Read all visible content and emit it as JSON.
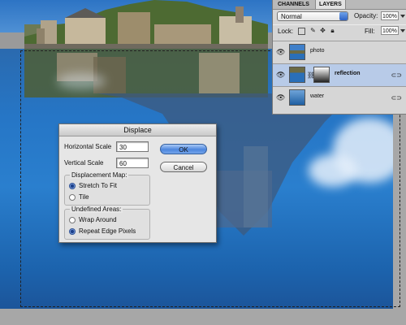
{
  "colors": {
    "panel_bg": "#d6d6d6",
    "selected_layer": "#b8cbe8",
    "dialog_bg": "#e6e6e6",
    "ok_button": "#4d86de",
    "water_blue": "#2676c6"
  },
  "layers_panel": {
    "tabs": [
      "CHANNELS",
      "LAYERS"
    ],
    "active_tab": "LAYERS",
    "blend_mode": "Normal",
    "opacity_label": "Opacity:",
    "opacity_value": "100%",
    "lock_label": "Lock:",
    "fill_label": "Fill:",
    "fill_value": "100%",
    "lock_icons": [
      "lock-transparency-icon",
      "lock-image-icon",
      "lock-position-icon",
      "lock-all-icon"
    ],
    "layers": [
      {
        "name": "photo",
        "visible": true,
        "selected": false,
        "has_mask": false
      },
      {
        "name": "reflection",
        "visible": true,
        "selected": true,
        "has_mask": true
      },
      {
        "name": "water",
        "visible": true,
        "selected": false,
        "has_mask": false
      }
    ]
  },
  "dialog": {
    "title": "Displace",
    "horizontal_scale_label": "Horizontal Scale",
    "horizontal_scale_value": "30",
    "vertical_scale_label": "Vertical Scale",
    "vertical_scale_value": "60",
    "displacement_map_title": "Displacement Map:",
    "displacement_options": [
      "Stretch To Fit",
      "Tile"
    ],
    "displacement_selected": "Stretch To Fit",
    "undefined_areas_title": "Undefined Areas:",
    "undefined_options": [
      "Wrap Around",
      "Repeat Edge Pixels"
    ],
    "undefined_selected": "Repeat Edge Pixels",
    "ok_label": "OK",
    "cancel_label": "Cancel"
  }
}
